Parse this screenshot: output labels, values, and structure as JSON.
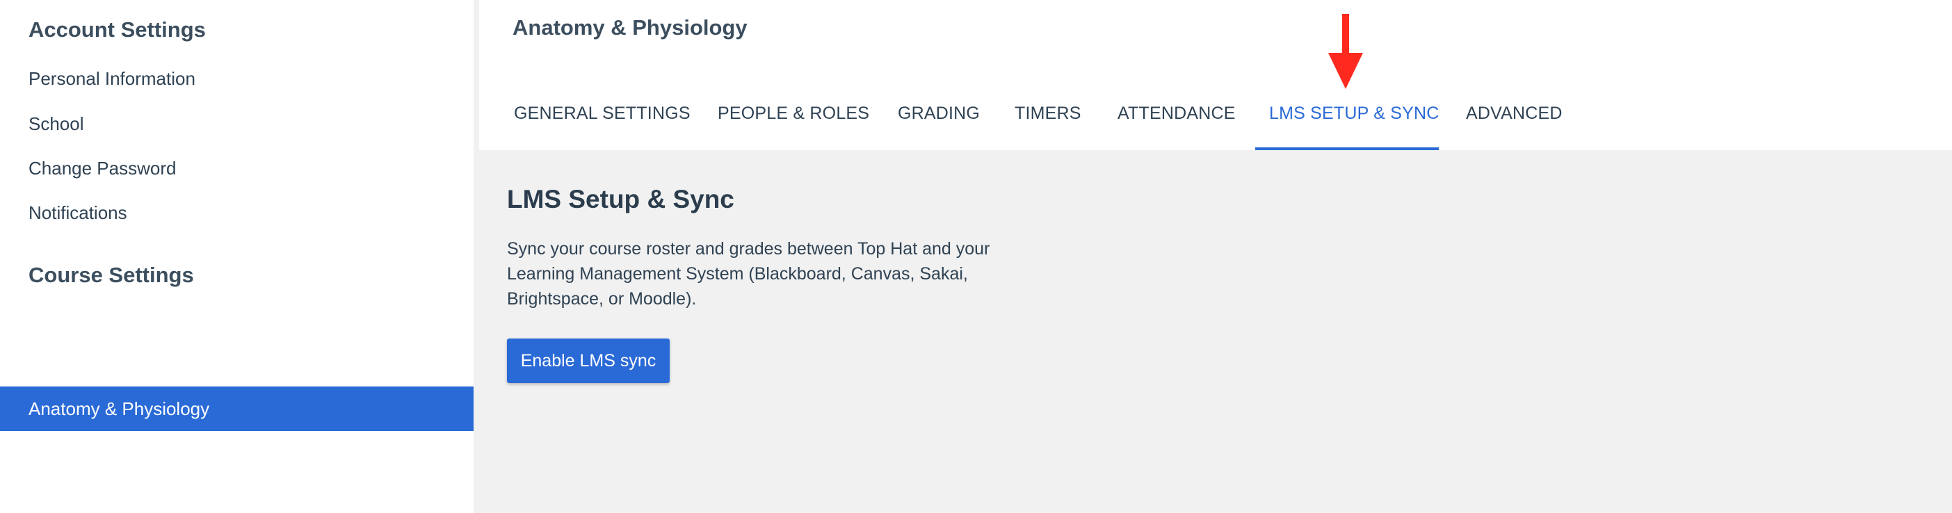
{
  "sidebar": {
    "account_heading": "Account Settings",
    "account_items": [
      {
        "label": "Personal Information"
      },
      {
        "label": "School"
      },
      {
        "label": "Change Password"
      },
      {
        "label": "Notifications"
      }
    ],
    "course_heading": "Course Settings",
    "courses": [
      {
        "label": "Anatomy & Physiology",
        "selected": true
      }
    ]
  },
  "header": {
    "course_title": "Anatomy & Physiology",
    "tabs": [
      {
        "label": "GENERAL SETTINGS",
        "active": false
      },
      {
        "label": "PEOPLE & ROLES",
        "active": false
      },
      {
        "label": "GRADING",
        "active": false
      },
      {
        "label": "TIMERS",
        "active": false
      },
      {
        "label": "ATTENDANCE",
        "active": false
      },
      {
        "label": "LMS SETUP & SYNC",
        "active": true
      },
      {
        "label": "ADVANCED",
        "active": false
      }
    ]
  },
  "content": {
    "heading": "LMS Setup & Sync",
    "description": "Sync your course roster and grades between Top Hat and your Learning Management System (Blackboard, Canvas, Sakai, Brightspace, or Moodle).",
    "enable_button_label": "Enable LMS sync"
  },
  "annotation": {
    "icon": "red-arrow-down",
    "color": "#ff2a1f"
  },
  "colors": {
    "accent": "#2a6ad6",
    "text": "#2f4253",
    "background": "#f1f1f1"
  }
}
